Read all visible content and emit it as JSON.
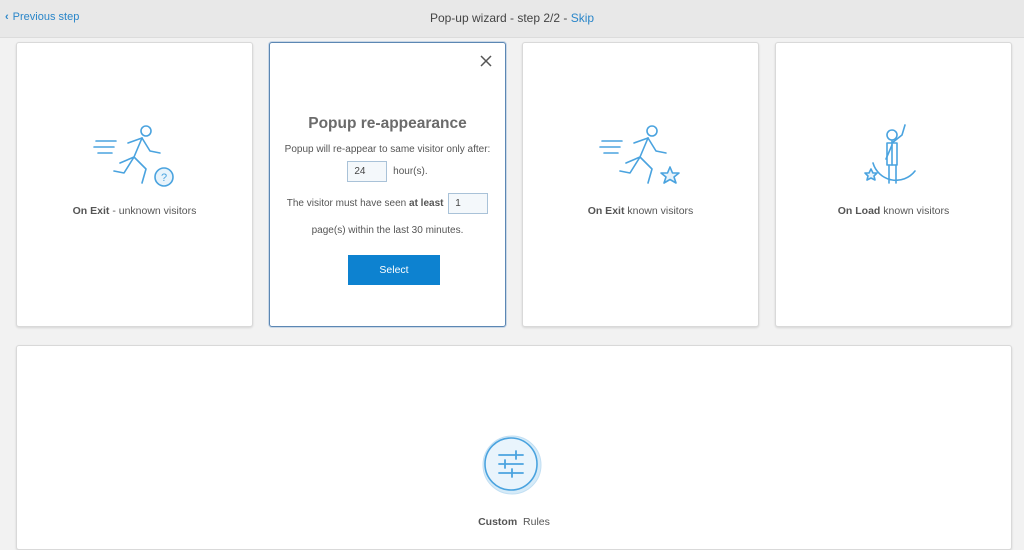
{
  "header": {
    "previous_step": "Previous step",
    "title": "Pop-up wizard - step 2/2 - ",
    "skip": "Skip"
  },
  "cards": [
    {
      "bold": "On Exit",
      "text": " - unknown visitors",
      "icon": "running-person-question-icon"
    },
    {
      "bold": "On Exit",
      "text": " known visitors",
      "icon": "running-person-star-icon"
    },
    {
      "bold": "On Load",
      "text": " known visitors",
      "icon": "waving-person-star-icon"
    }
  ],
  "popup": {
    "title": "Popup re-appearance",
    "line1": "Popup will re-appear to same visitor only after:",
    "hours_value": "24",
    "hours_unit": "hour(s).",
    "line3_prefix": "The visitor must have seen ",
    "line3_bold": "at least",
    "pages_value": "1",
    "line4": "page(s) within the last 30 minutes.",
    "select_label": "Select"
  },
  "custom": {
    "bold": "Custom",
    "text": "Rules",
    "icon": "sliders-icon"
  },
  "colors": {
    "accent": "#0d82d0",
    "icon_blue": "#4aa3df",
    "link": "#2a86c9"
  }
}
